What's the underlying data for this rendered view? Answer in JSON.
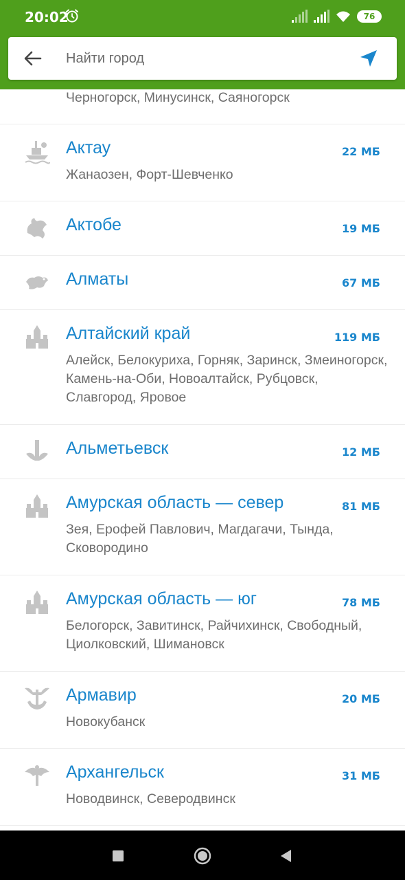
{
  "status_bar": {
    "time": "20:02",
    "battery": "76",
    "icons": [
      "alarm-icon",
      "signal-icon",
      "signal-icon",
      "wifi-icon",
      "battery-icon"
    ]
  },
  "search": {
    "placeholder": "Найти город",
    "value": "",
    "back_icon": "arrow-left-icon",
    "locate_icon": "location-arrow-icon"
  },
  "colors": {
    "header_green": "#4f9f1c",
    "accent_blue": "#1a86cc",
    "subtitle_gray": "#6e6e6e",
    "icon_gray": "#c4c4c4"
  },
  "list": {
    "partial_row": {
      "subtitle": "Черногорск, Минусинск, Саяногорск"
    },
    "items": [
      {
        "icon": "ship-emblem-icon",
        "title": "Актау",
        "size": "22 МБ",
        "subtitle": "Жанаозен, Форт-Шевченко"
      },
      {
        "icon": "griffin-emblem-icon",
        "title": "Актобе",
        "size": "19 МБ",
        "subtitle": ""
      },
      {
        "icon": "snow-leopard-emblem-icon",
        "title": "Алматы",
        "size": "67 МБ",
        "subtitle": ""
      },
      {
        "icon": "kremlin-emblem-icon",
        "title": "Алтайский край",
        "size": "119 МБ",
        "subtitle": "Алейск, Белокуриха, Горняк, Заринск, Змеиногорск, Камень-на-Оби, Новоалтайск, Рубцовск, Славгород, Яровое"
      },
      {
        "icon": "tower-emblem-icon",
        "title": "Альметьевск",
        "size": "12 МБ",
        "subtitle": ""
      },
      {
        "icon": "kremlin-emblem-icon",
        "title": "Амурская область — север",
        "size": "81 МБ",
        "subtitle": "Зея, Ерофей Павлович, Магдагачи, Тында, Сковородино"
      },
      {
        "icon": "kremlin-emblem-icon",
        "title": "Амурская область — юг",
        "size": "78 МБ",
        "subtitle": "Белогорск, Завитинск, Райчихинск, Свободный, Циолковский, Шимановск"
      },
      {
        "icon": "anchor-emblem-icon",
        "title": "Армавир",
        "size": "20 МБ",
        "subtitle": "Новокубанск"
      },
      {
        "icon": "archangel-emblem-icon",
        "title": "Архангельск",
        "size": "31 МБ",
        "subtitle": "Новодвинск, Северодвинск"
      }
    ]
  },
  "nav_bar": {
    "buttons": [
      "recents-square-icon",
      "home-circle-icon",
      "back-triangle-icon"
    ]
  }
}
